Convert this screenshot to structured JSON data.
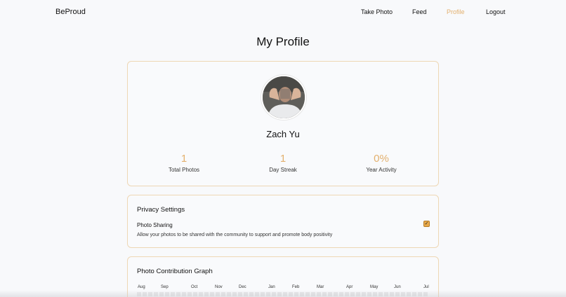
{
  "nav": {
    "brand": "BeProud",
    "links": [
      {
        "label": "Take Photo",
        "active": false
      },
      {
        "label": "Feed",
        "active": false
      },
      {
        "label": "Profile",
        "active": true
      },
      {
        "label": "Logout",
        "active": false
      }
    ]
  },
  "page_title": "My Profile",
  "profile": {
    "name": "Zach Yu",
    "stats": [
      {
        "value": "1",
        "label": "Total Photos"
      },
      {
        "value": "1",
        "label": "Day Streak"
      },
      {
        "value": "0%",
        "label": "Year Activity"
      }
    ]
  },
  "privacy": {
    "title": "Privacy Settings",
    "setting_label": "Photo Sharing",
    "setting_description": "Allow your photos to be shared with the community to support and promote body positivity",
    "photo_sharing_checked": true
  },
  "graph": {
    "title": "Photo Contribution Graph",
    "months": [
      "Aug",
      "Sep",
      "Oct",
      "Nov",
      "Dec",
      "Jan",
      "Feb",
      "Mar",
      "Apr",
      "May",
      "Jun",
      "Jul"
    ]
  },
  "colors": {
    "accent": "#e3b06e",
    "card_border": "#eed7b4",
    "background": "#f8f9fb"
  }
}
